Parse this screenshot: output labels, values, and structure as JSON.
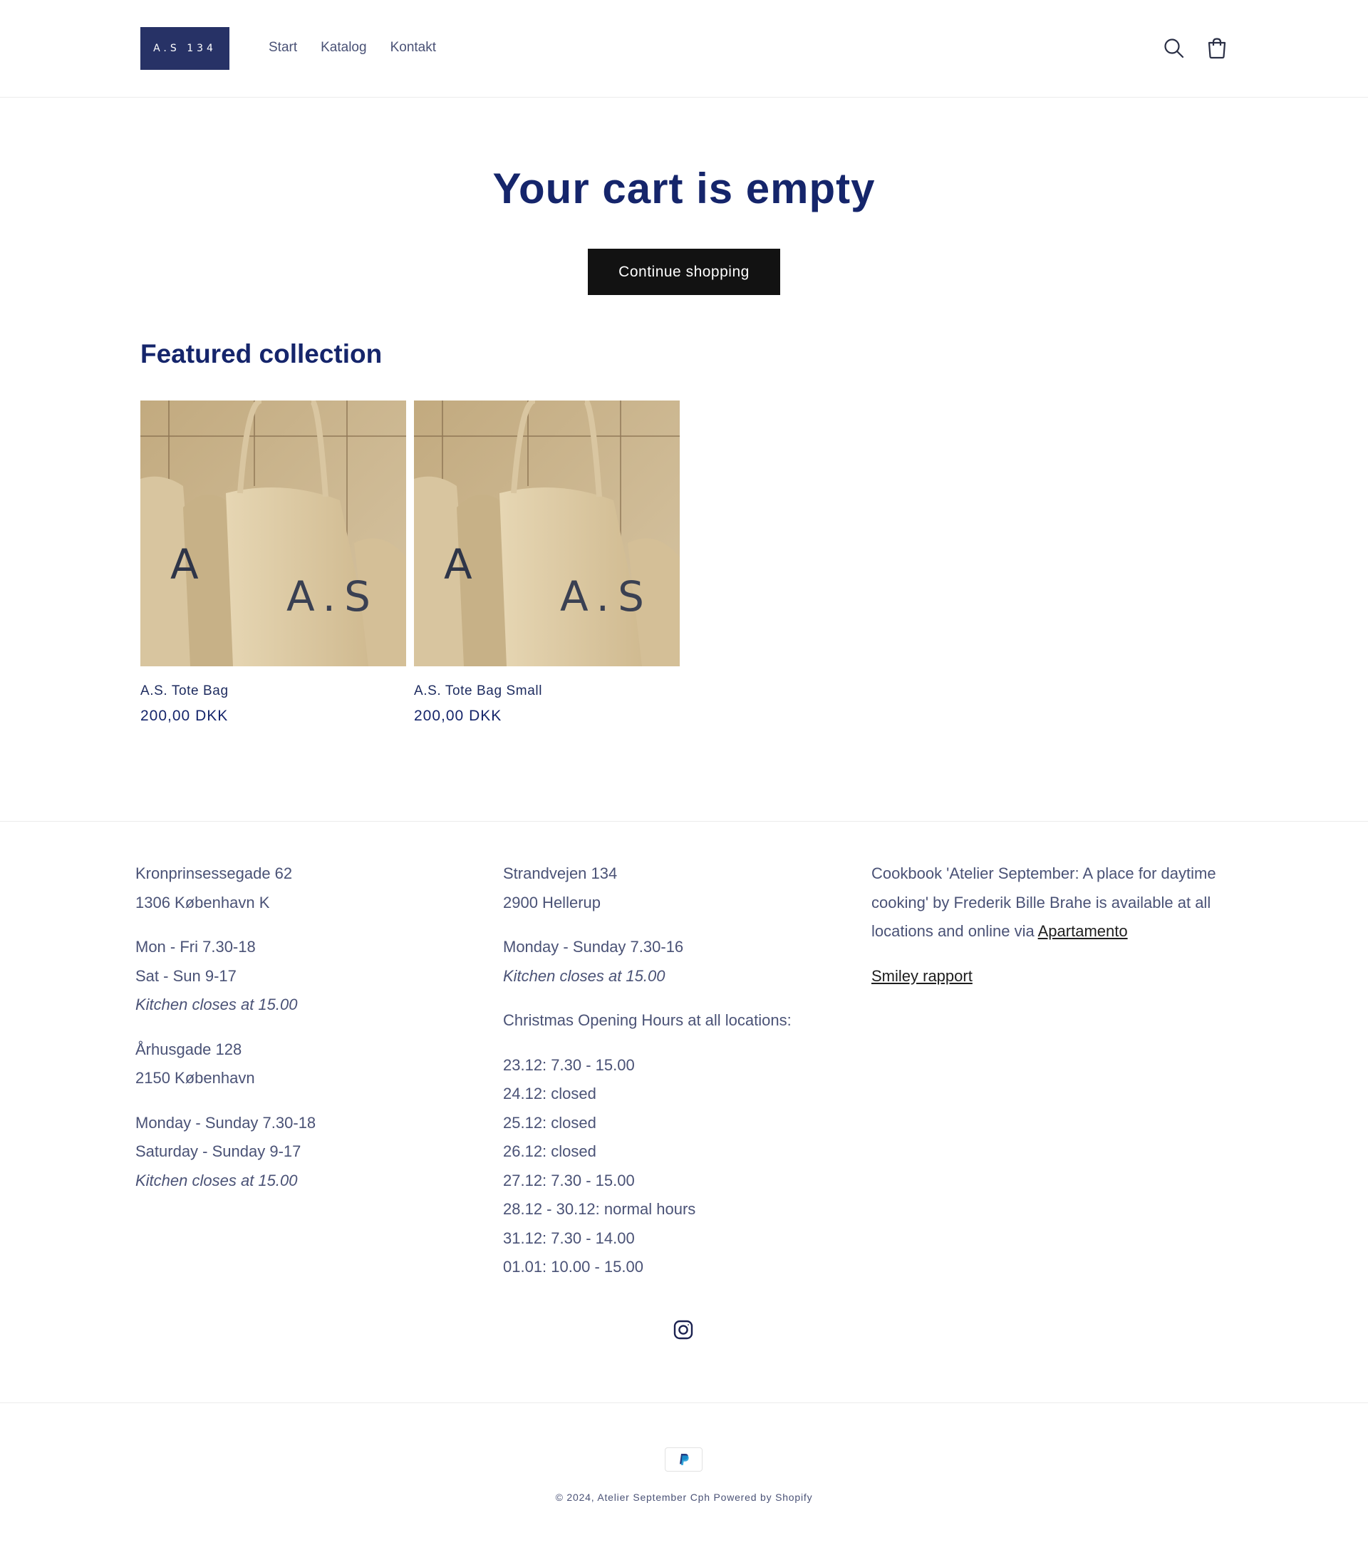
{
  "header": {
    "logo_text": "A.S 134",
    "nav": [
      "Start",
      "Katalog",
      "Kontakt"
    ],
    "icons": [
      "search-icon",
      "cart-icon"
    ]
  },
  "cart": {
    "title": "Your cart is empty",
    "continue_label": "Continue shopping"
  },
  "featured": {
    "title": "Featured collection",
    "products": [
      {
        "name": "A.S. Tote Bag",
        "price": "200,00 DKK"
      },
      {
        "name": "A.S. Tote Bag Small",
        "price": "200,00 DKK"
      }
    ]
  },
  "footer": {
    "col1": {
      "address1_line1": "Kronprinsessegade 62",
      "address1_line2": "1306 København K",
      "hours1_line1": "Mon - Fri 7.30-18",
      "hours1_line2": "Sat - Sun 9-17",
      "kitchen1": "Kitchen closes at 15.00",
      "address2_line1": "Århusgade 128",
      "address2_line2": "2150 København",
      "hours2_line1": "Monday - Sunday 7.30-18",
      "hours2_line2": "Saturday - Sunday 9-17",
      "kitchen2": "Kitchen closes at 15.00"
    },
    "col2": {
      "address_line1": "Strandvejen 134",
      "address_line2": "2900 Hellerup",
      "hours": "Monday - Sunday 7.30-16",
      "kitchen": "Kitchen closes at 15.00",
      "christmas_title": "Christmas Opening Hours at all locations:",
      "christmas_hours": [
        "23.12: 7.30 - 15.00",
        "24.12: closed",
        "25.12: closed",
        "26.12: closed",
        "27.12: 7.30 - 15.00",
        "28.12 - 30.12: normal hours",
        "31.12: 7.30 - 14.00",
        "01.01: 10.00 - 15.00"
      ]
    },
    "col3": {
      "cookbook_text": "Cookbook 'Atelier September: A place for daytime cooking' by Frederik Bille Brahe is available at all locations and online via ",
      "cookbook_link": "Apartamento",
      "smiley_link": "Smiley rapport"
    },
    "social_icon": "instagram-icon",
    "payment_icon": "paypal-icon",
    "copyright": "© 2024, Atelier September Cph Powered by Shopify"
  }
}
